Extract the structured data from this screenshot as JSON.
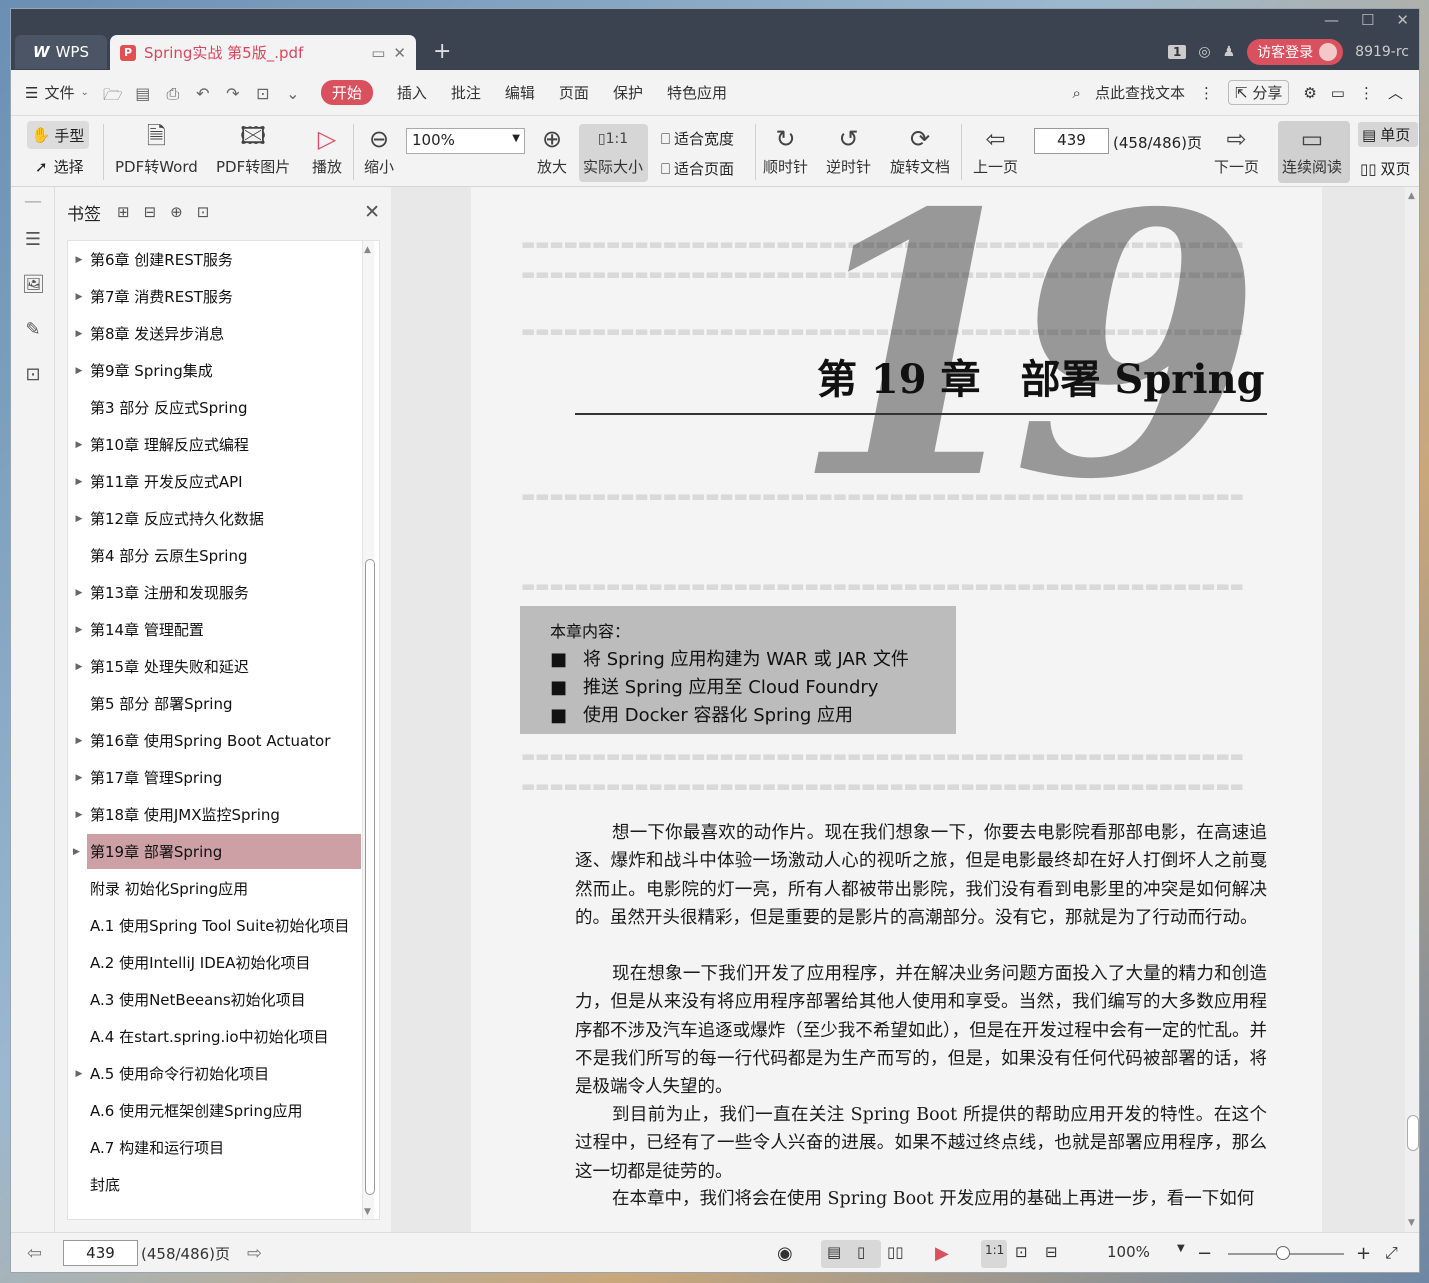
{
  "titlebar": {
    "app_name": "WPS",
    "doc_tab_title": "Spring实战 第5版_.pdf",
    "new_tab": "+",
    "badge": "1",
    "login_label": "访客登录",
    "version": "8919-rc"
  },
  "menu": {
    "file": "文件",
    "items": [
      "开始",
      "插入",
      "批注",
      "编辑",
      "页面",
      "保护",
      "特色应用"
    ],
    "search": "点此查找文本",
    "share": "分享"
  },
  "toolbar": {
    "hand": "手型",
    "select": "选择",
    "pdf_to_word": "PDF转Word",
    "pdf_to_image": "PDF转图片",
    "play": "播放",
    "zoom_out": "缩小",
    "zoom_value": "100%",
    "zoom_in": "放大",
    "actual_size": "实际大小",
    "fit_width": "适合宽度",
    "fit_page": "适合页面",
    "clockwise": "顺时针",
    "counter_clockwise": "逆时针",
    "rotate_doc": "旋转文档",
    "prev_page": "上一页",
    "page_input": "439",
    "page_total": "(458/486)页",
    "next_page": "下一页",
    "continuous": "连续阅读",
    "single": "单页",
    "double": "双页"
  },
  "bookmarks": {
    "title": "书签",
    "items": [
      {
        "label": "第6章 创建REST服务",
        "arrow": "▶"
      },
      {
        "label": "第7章 消费REST服务",
        "arrow": "▶"
      },
      {
        "label": "第8章 发送异步消息",
        "arrow": "▶"
      },
      {
        "label": "第9章 Spring集成",
        "arrow": "▶"
      },
      {
        "label": "第3 部分 反应式Spring",
        "arrow": ""
      },
      {
        "label": "第10章 理解反应式编程",
        "arrow": "▶"
      },
      {
        "label": "第11章 开发反应式API",
        "arrow": "▶"
      },
      {
        "label": "第12章 反应式持久化数据",
        "arrow": "▶"
      },
      {
        "label": "第4 部分 云原生Spring",
        "arrow": ""
      },
      {
        "label": "第13章 注册和发现服务",
        "arrow": "▶"
      },
      {
        "label": "第14章 管理配置",
        "arrow": "▶"
      },
      {
        "label": "第15章 处理失败和延迟",
        "arrow": "▶"
      },
      {
        "label": "第5 部分 部署Spring",
        "arrow": ""
      },
      {
        "label": "第16章 使用Spring Boot Actuator",
        "arrow": "▶"
      },
      {
        "label": "第17章 管理Spring",
        "arrow": "▶"
      },
      {
        "label": "第18章 使用JMX监控Spring",
        "arrow": "▶"
      },
      {
        "label": "第19章 部署Spring",
        "arrow": "▶"
      },
      {
        "label": "附录 初始化Spring应用",
        "arrow": ""
      },
      {
        "label": "A.1 使用Spring Tool Suite初始化项目",
        "arrow": ""
      },
      {
        "label": "A.2 使用IntelliJ IDEA初始化项目",
        "arrow": ""
      },
      {
        "label": "A.3 使用NetBeeans初始化项目",
        "arrow": ""
      },
      {
        "label": "A.4 在start.spring.io中初始化项目",
        "arrow": ""
      },
      {
        "label": "A.5 使用命令行初始化项目",
        "arrow": "▶"
      },
      {
        "label": "A.6 使用元框架创建Spring应用",
        "arrow": ""
      },
      {
        "label": "A.7 构建和运行项目",
        "arrow": ""
      },
      {
        "label": "封底",
        "arrow": ""
      }
    ]
  },
  "page": {
    "chapter_title": "第 19 章　部署 Spring",
    "chapter_number": "19",
    "contents_heading": "本章内容：",
    "contents": [
      "将 Spring 应用构建为 WAR 或 JAR 文件",
      "推送 Spring 应用至 Cloud Foundry",
      "使用 Docker 容器化 Spring 应用"
    ],
    "bullet": "■",
    "paragraphs": [
      "想一下你最喜欢的动作片。现在我们想象一下，你要去电影院看那部电影，在高速追逐、爆炸和战斗中体验一场激动人心的视听之旅，但是电影最终却在好人打倒坏人之前戛然而止。电影院的灯一亮，所有人都被带出影院，我们没有看到电影里的冲突是如何解决的。虽然开头很精彩，但是重要的是影片的高潮部分。没有它，那就是为了行动而行动。",
      "现在想象一下我们开发了应用程序，并在解决业务问题方面投入了大量的精力和创造力，但是从来没有将应用程序部署给其他人使用和享受。当然，我们编写的大多数应用程序都不涉及汽车追逐或爆炸（至少我不希望如此），但是在开发过程中会有一定的忙乱。并不是我们所写的每一行代码都是为生产而写的，但是，如果没有任何代码被部署的话，将是极端令人失望的。",
      "到目前为止，我们一直在关注 Spring Boot 所提供的帮助应用开发的特性。在这个过程中，已经有了一些令人兴奋的进展。如果不越过终点线，也就是部署应用程序，那么这一切都是徒劳的。",
      "在本章中，我们将会在使用 Spring Boot 开发应用的基础上再进一步，看一下如何"
    ]
  },
  "status": {
    "page_input": "439",
    "page_total": "(458/486)页",
    "zoom": "100%"
  },
  "colors": {
    "accent": "#d9505f",
    "selected_bookmark": "#cda0a6",
    "titlebar": "#3b4351"
  }
}
